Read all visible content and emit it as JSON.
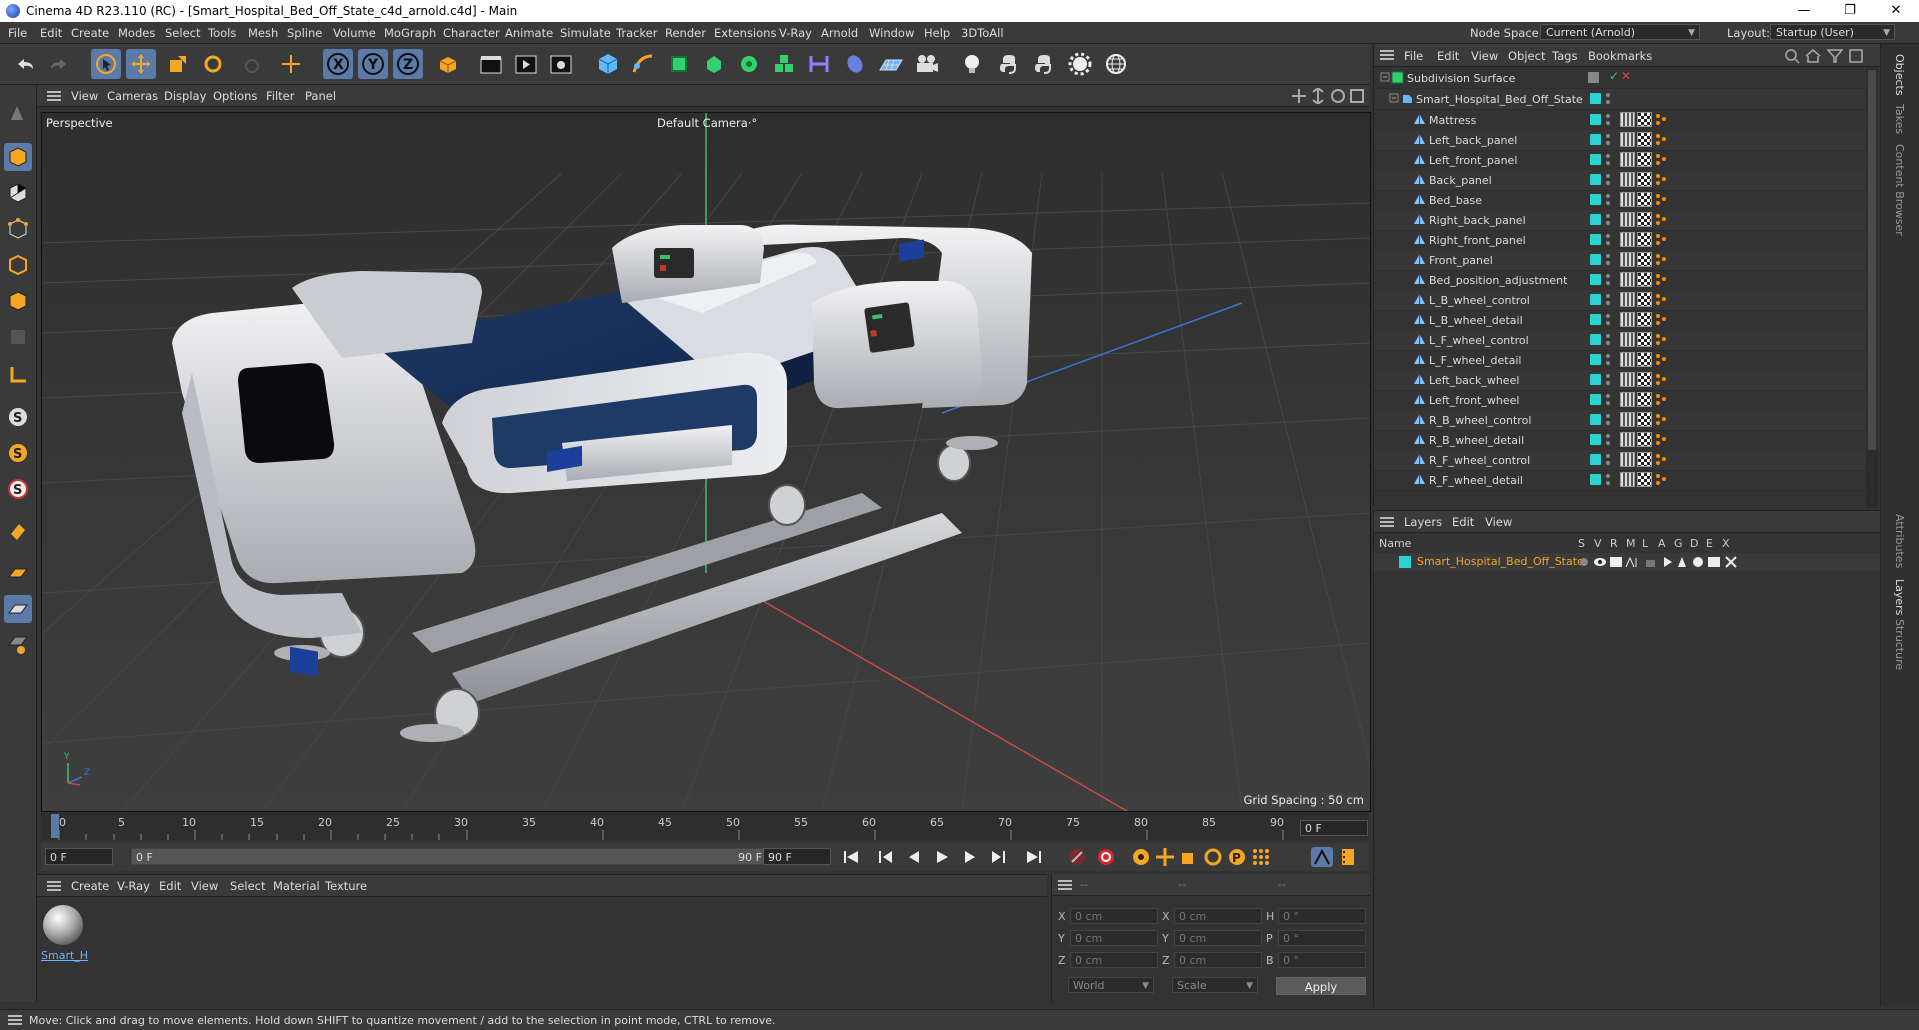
{
  "window": {
    "title": "Cinema 4D R23.110 (RC) - [Smart_Hospital_Bed_Off_State_c4d_arnold.c4d] - Main",
    "minimize": "—",
    "maximize": "❐",
    "close": "✕"
  },
  "menubar": {
    "items": [
      "File",
      "Edit",
      "Create",
      "Modes",
      "Select",
      "Tools",
      "Mesh",
      "Spline",
      "Volume",
      "MoGraph",
      "Character",
      "Animate",
      "Simulate",
      "Tracker",
      "Render",
      "Extensions",
      "V-Ray",
      "Arnold",
      "Window",
      "Help",
      "3DToAll"
    ],
    "node_space_label": "Node Space:",
    "node_space_value": "Current (Arnold)",
    "layout_label": "Layout:",
    "layout_value": "Startup (User)"
  },
  "viewport": {
    "menu": [
      "View",
      "Cameras",
      "Display",
      "Options",
      "Filter",
      "Panel"
    ],
    "perspective_label": "Perspective",
    "camera_label": "Default Camera",
    "camera_suffix": "·°",
    "grid_spacing": "Grid Spacing : 50 cm",
    "axis_y": "Y",
    "axis_z": "Z",
    "axis_x": "X",
    "colors": {
      "background": "#3c3c3c",
      "grid": "#4a4a4a",
      "axis_green": "#3cbf6c",
      "axis_red": "#c84a40",
      "axis_blue": "#3a74d0"
    }
  },
  "timeline": {
    "ticks": [
      "0",
      "5",
      "10",
      "15",
      "20",
      "25",
      "30",
      "35",
      "40",
      "45",
      "50",
      "55",
      "60",
      "65",
      "70",
      "75",
      "80",
      "85",
      "90"
    ],
    "current_frame_right": "0 F",
    "start_field": "0 F",
    "slider_start": "0 F",
    "slider_end": "90 F",
    "end_field": "90 F"
  },
  "material_manager": {
    "menu": [
      "Create",
      "V-Ray",
      "Edit",
      "View",
      "Select",
      "Material",
      "Texture"
    ],
    "materials": [
      {
        "label": "Smart_H"
      }
    ]
  },
  "attributes": {
    "header": [
      "--",
      "--",
      "--"
    ],
    "rows": [
      {
        "a": "X",
        "av": "0 cm",
        "b": "X",
        "bv": "0 cm",
        "c": "H",
        "cv": "0 °"
      },
      {
        "a": "Y",
        "av": "0 cm",
        "b": "Y",
        "bv": "0 cm",
        "c": "P",
        "cv": "0 °"
      },
      {
        "a": "Z",
        "av": "0 cm",
        "b": "Z",
        "bv": "0 cm",
        "c": "B",
        "cv": "0 °"
      }
    ],
    "coord_mode": "World",
    "scale_mode": "Scale",
    "apply": "Apply"
  },
  "object_manager": {
    "menu": [
      "File",
      "Edit",
      "View",
      "Object",
      "Tags",
      "Bookmarks"
    ],
    "root": "Subdivision Surface",
    "group": "Smart_Hospital_Bed_Off_State",
    "children": [
      "Mattress",
      "Left_back_panel",
      "Left_front_panel",
      "Back_panel",
      "Bed_base",
      "Right_back_panel",
      "Right_front_panel",
      "Front_panel",
      "Bed_position_adjustment",
      "L_B_wheel_control",
      "L_B_wheel_detail",
      "L_F_wheel_control",
      "L_F_wheel_detail",
      "Left_back_wheel",
      "Left_front_wheel",
      "R_B_wheel_control",
      "R_B_wheel_detail",
      "R_F_wheel_control",
      "R_F_wheel_detail"
    ]
  },
  "layers": {
    "menu": [
      "Layers",
      "Edit",
      "View"
    ],
    "columns": [
      "Name",
      "S",
      "V",
      "R",
      "M",
      "L",
      "A",
      "G",
      "D",
      "E",
      "X"
    ],
    "rows": [
      {
        "name": "Smart_Hospital_Bed_Off_State",
        "color": "#2ad2d2"
      }
    ]
  },
  "side_tabs": [
    "Objects",
    "Takes",
    "Content Browser",
    "Attributes",
    "Layers",
    "Structure"
  ],
  "status": {
    "text": "Move: Click and drag to move elements. Hold down SHIFT to quantize movement / add to the selection in point mode, CTRL to remove."
  }
}
